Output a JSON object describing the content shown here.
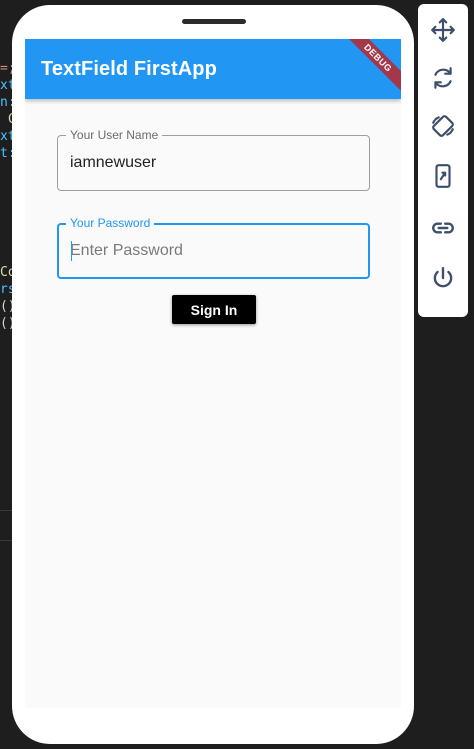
{
  "appbar": {
    "title": "TextField FirstApp",
    "debug_banner": "DEBUG"
  },
  "username_field": {
    "label": "Your User Name",
    "value": "iamnewuser"
  },
  "password_field": {
    "label": "Your Password",
    "placeholder": "Enter Password"
  },
  "signin_button": {
    "label": "Sign In"
  },
  "toolbar": {
    "items": [
      "move-icon",
      "rotate-refresh-icon",
      "rotate-device-icon",
      "resize-screen-icon",
      "link-icon",
      "power-icon"
    ]
  },
  "colors": {
    "primary": "#2196f3",
    "debug": "#a3384a",
    "button": "#000000",
    "background": "#fafafa"
  }
}
